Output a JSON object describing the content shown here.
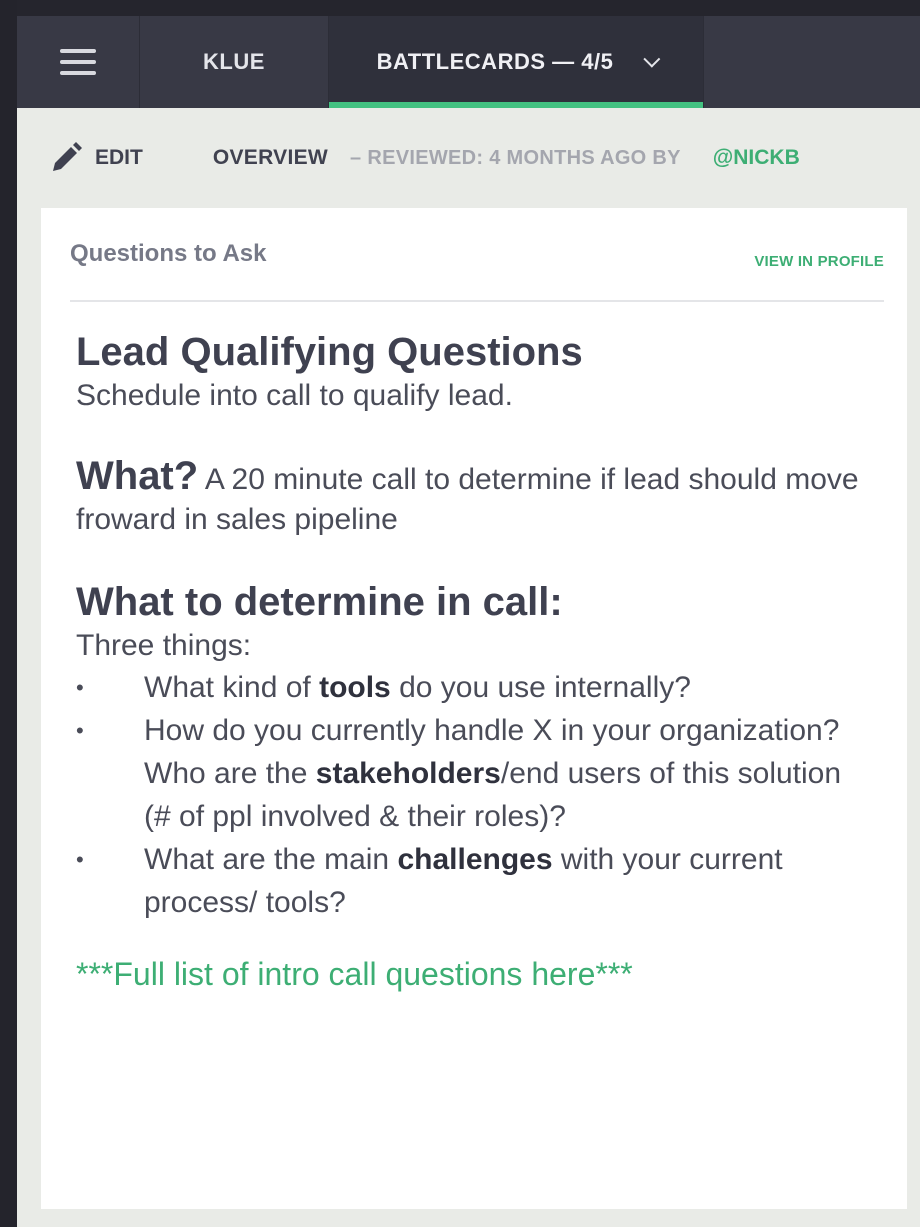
{
  "topbar": {
    "menu_icon": "hamburger-icon",
    "tabs": [
      {
        "label": "KLUE"
      },
      {
        "label": "BATTLECARDS — 4/5",
        "dropdown_icon": "chevron-down-icon"
      }
    ],
    "accent_color": "#43c181"
  },
  "subheader": {
    "edit_icon": "pencil-icon",
    "edit_label": "EDIT",
    "section": "OVERVIEW",
    "reviewed": "– REVIEWED: 4 MONTHS AGO BY",
    "author": "@NICKB"
  },
  "card": {
    "title": "Questions to Ask",
    "view_profile": "VIEW IN PROFILE",
    "heading": "Lead Qualifying Questions",
    "subheading": "Schedule into call to qualify lead.",
    "what_label": "What?",
    "what_text": " A 20 minute call to determine if lead should move froward in sales pipeline",
    "determine_heading": "What to determine in call:",
    "three_things": "Three things:",
    "questions": [
      {
        "pre": "What kind of ",
        "bold": "tools",
        "post": " do you use internally?"
      },
      {
        "pre": "How do you currently handle X in your organization? Who are the ",
        "bold": "stakeholders",
        "post": "/end users of this solution (# of ppl involved & their roles)?"
      },
      {
        "pre": "What are the main ",
        "bold": "challenges",
        "post": " with your current process/ tools?"
      }
    ],
    "footer_link": "***Full list of intro call questions here***"
  }
}
